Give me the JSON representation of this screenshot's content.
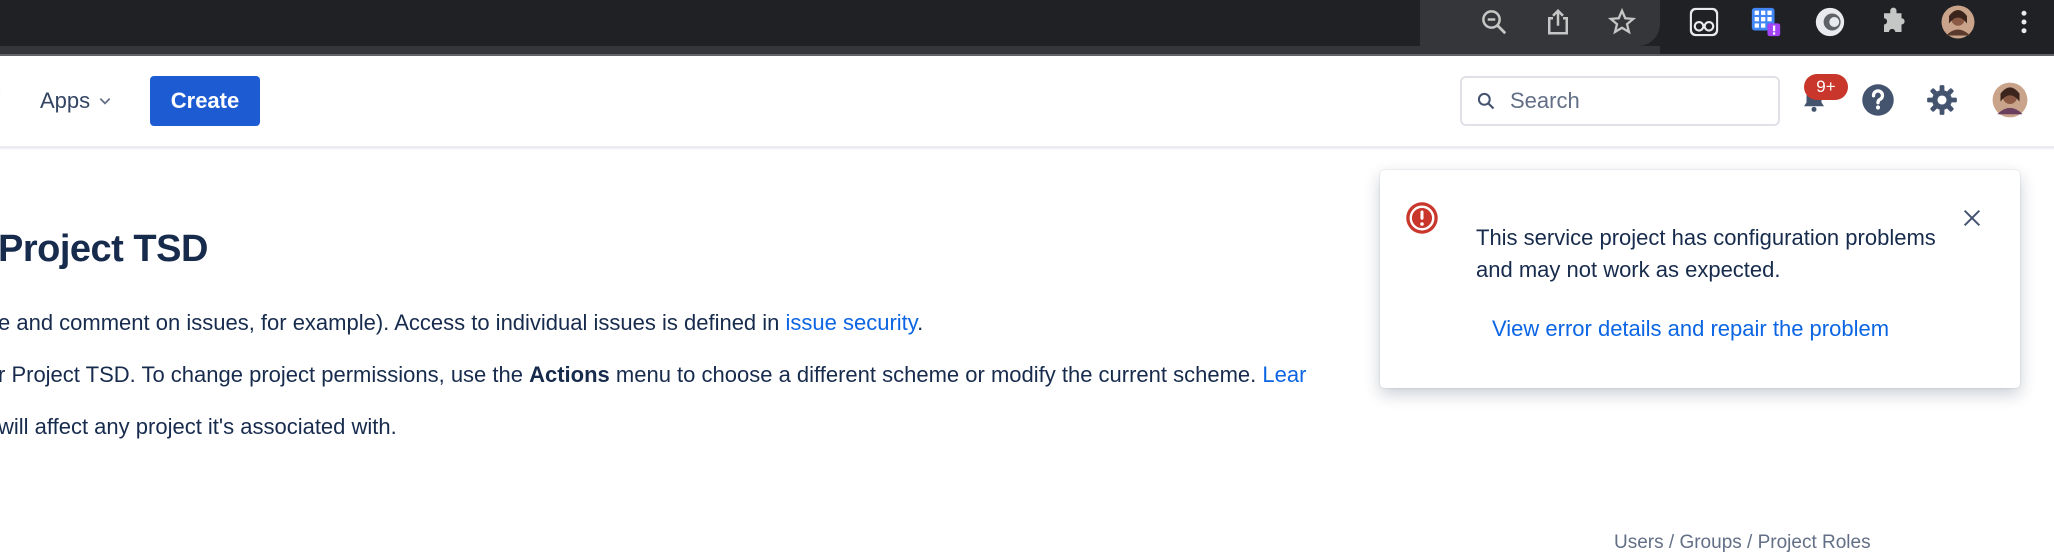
{
  "browser": {
    "icons": [
      "zoom-out-icon",
      "share-icon",
      "bookmark-star-icon",
      "extension-glasses-icon",
      "extension-grid-icon",
      "extension-circle-icon",
      "extensions-puzzle-icon",
      "profile-avatar-icon",
      "menu-kebab-icon"
    ]
  },
  "topnav": {
    "apps_label": "Apps",
    "create_label": "Create",
    "search_placeholder": "Search",
    "notifications_badge": "9+"
  },
  "page": {
    "heading": "Project TSD",
    "para1_text": "e and comment on issues, for example). Access to individual issues is defined in ",
    "para1_link": "issue security",
    "para1_end": ".",
    "para2_text": "r Project TSD. To change project permissions, use the ",
    "para2_bold": "Actions",
    "para2_rest": " menu to choose a different scheme or modify the current scheme. ",
    "para2_link": "Lear",
    "para3_text": " will affect any project it's associated with.",
    "footer_links": "Users / Groups / Project Roles"
  },
  "flag": {
    "message": "This service project has configuration problems and may not work as expected.",
    "action_label": "View error details and repair the problem"
  },
  "colors": {
    "chrome_bg": "#202124",
    "primary": "#1d5bd3",
    "link": "#0c66e4",
    "error": "#c9372c",
    "text": "#172b4d"
  }
}
